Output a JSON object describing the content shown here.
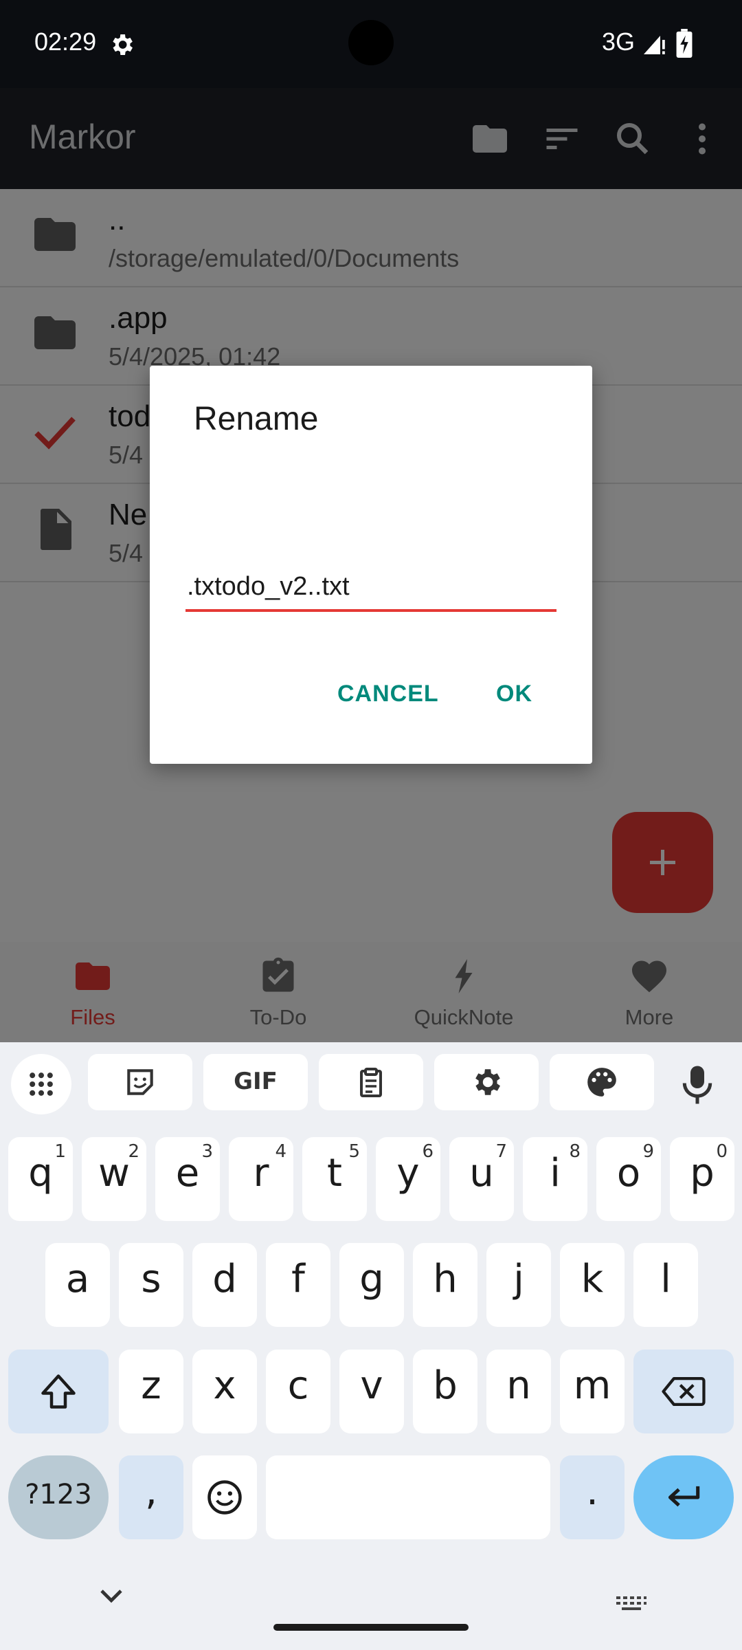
{
  "status_bar": {
    "time": "02:29",
    "network": "3G",
    "icons": [
      "settings-gear-icon",
      "signal-icon",
      "battery-charging-icon"
    ]
  },
  "app_bar": {
    "title": "Markor",
    "actions": [
      "folder-icon",
      "sort-icon",
      "search-icon",
      "more-vert-icon"
    ]
  },
  "files": [
    {
      "name": "..",
      "subtitle": "/storage/emulated/0/Documents",
      "icon": "folder-icon"
    },
    {
      "name": ".app",
      "subtitle": "5/4/2025, 01:42",
      "icon": "folder-icon"
    },
    {
      "name": "tod",
      "subtitle": "5/4",
      "icon": "checkmark-icon"
    },
    {
      "name": "Ne",
      "subtitle": "5/4",
      "icon": "file-icon"
    }
  ],
  "fab": {
    "icon": "plus-icon"
  },
  "bottom_nav": [
    {
      "label": "Files",
      "icon": "folder-icon",
      "active": true
    },
    {
      "label": "To-Do",
      "icon": "clipboard-check-icon",
      "active": false
    },
    {
      "label": "QuickNote",
      "icon": "bolt-icon",
      "active": false
    },
    {
      "label": "More",
      "icon": "heart-icon",
      "active": false
    }
  ],
  "dialog": {
    "title": "Rename",
    "input_value": ".txtodo_v2..txt",
    "cancel_label": "CANCEL",
    "ok_label": "OK"
  },
  "keyboard": {
    "toolbar": [
      "apps-grid-icon",
      "sticker-icon",
      "gif-icon",
      "clipboard-icon",
      "settings-icon",
      "palette-icon",
      "mic-icon"
    ],
    "gif_label": "GIF",
    "row1": [
      {
        "ch": "q",
        "hint": "1"
      },
      {
        "ch": "w",
        "hint": "2"
      },
      {
        "ch": "e",
        "hint": "3"
      },
      {
        "ch": "r",
        "hint": "4"
      },
      {
        "ch": "t",
        "hint": "5"
      },
      {
        "ch": "y",
        "hint": "6"
      },
      {
        "ch": "u",
        "hint": "7"
      },
      {
        "ch": "i",
        "hint": "8"
      },
      {
        "ch": "o",
        "hint": "9"
      },
      {
        "ch": "p",
        "hint": "0"
      }
    ],
    "row2": [
      "a",
      "s",
      "d",
      "f",
      "g",
      "h",
      "j",
      "k",
      "l"
    ],
    "row3": [
      "z",
      "x",
      "c",
      "v",
      "b",
      "n",
      "m"
    ],
    "sym_label": "?123",
    "comma": ",",
    "period": ".",
    "colors": {
      "mod": "#d8e5f4",
      "enter": "#6fc3f5",
      "accent": "#e53935",
      "dialog_button": "#00897b"
    }
  }
}
